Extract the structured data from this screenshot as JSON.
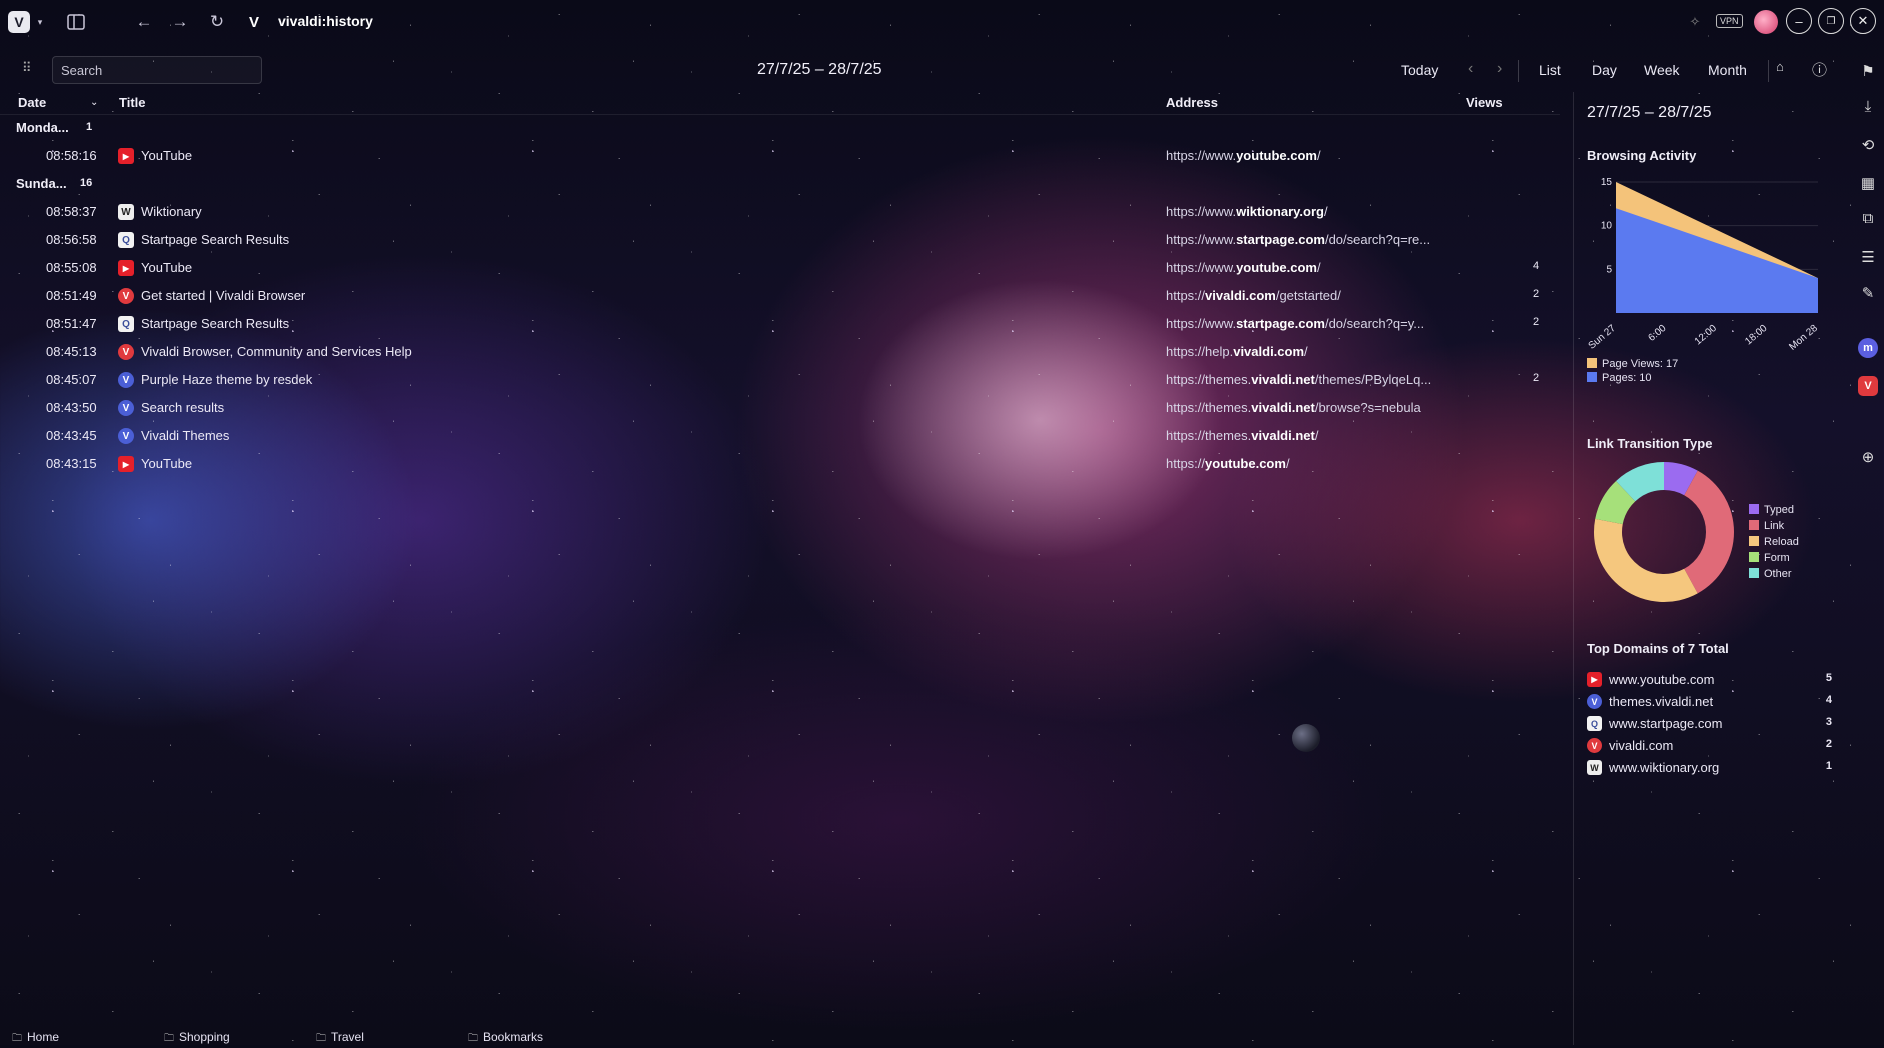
{
  "window": {
    "address": "vivaldi:history",
    "vpn_label": "VPN"
  },
  "toolbar": {
    "search_placeholder": "Search",
    "date_range": "27/7/25 – 28/7/25",
    "today": "Today",
    "views": [
      "List",
      "Day",
      "Week",
      "Month"
    ]
  },
  "table": {
    "headers": {
      "date": "Date",
      "title": "Title",
      "address": "Address",
      "views": "Views"
    },
    "groups": [
      {
        "label": "Monda...",
        "count": "1"
      },
      {
        "label": "Sunda...",
        "count": "16"
      }
    ],
    "rows": [
      {
        "time": "08:58:16",
        "icon": "youtube-favicon",
        "title": "YouTube",
        "url_pre": "https://www.",
        "url_bold": "youtube.com",
        "url_post": "/",
        "views": ""
      },
      {
        "time": "08:58:37",
        "icon": "wiktionary-favicon",
        "title": "Wiktionary",
        "url_pre": "https://www.",
        "url_bold": "wiktionary.org",
        "url_post": "/",
        "views": ""
      },
      {
        "time": "08:56:58",
        "icon": "startpage-favicon",
        "title": "Startpage Search Results",
        "url_pre": "https://www.",
        "url_bold": "startpage.com",
        "url_post": "/do/search?q=re...",
        "views": ""
      },
      {
        "time": "08:55:08",
        "icon": "youtube-favicon",
        "title": "YouTube",
        "url_pre": "https://www.",
        "url_bold": "youtube.com",
        "url_post": "/",
        "views": "4"
      },
      {
        "time": "08:51:49",
        "icon": "vivaldi-favicon",
        "title": "Get started | Vivaldi Browser",
        "url_pre": "https://",
        "url_bold": "vivaldi.com",
        "url_post": "/getstarted/",
        "views": "2"
      },
      {
        "time": "08:51:47",
        "icon": "startpage-favicon",
        "title": "Startpage Search Results",
        "url_pre": "https://www.",
        "url_bold": "startpage.com",
        "url_post": "/do/search?q=y...",
        "views": "2"
      },
      {
        "time": "08:45:13",
        "icon": "vivaldi-favicon",
        "title": "Vivaldi Browser, Community and Services Help",
        "url_pre": "https://help.",
        "url_bold": "vivaldi.com",
        "url_post": "/",
        "views": ""
      },
      {
        "time": "08:45:07",
        "icon": "vivaldi-themes-favicon",
        "title": "Purple Haze theme by resdek",
        "url_pre": "https://themes.",
        "url_bold": "vivaldi.net",
        "url_post": "/themes/PBylqeLq...",
        "views": "2"
      },
      {
        "time": "08:43:50",
        "icon": "vivaldi-themes-favicon",
        "title": "Search results",
        "url_pre": "https://themes.",
        "url_bold": "vivaldi.net",
        "url_post": "/browse?s=nebula",
        "views": ""
      },
      {
        "time": "08:43:45",
        "icon": "vivaldi-themes-favicon",
        "title": "Vivaldi Themes",
        "url_pre": "https://themes.",
        "url_bold": "vivaldi.net",
        "url_post": "/",
        "views": ""
      },
      {
        "time": "08:43:15",
        "icon": "youtube-favicon",
        "title": "YouTube",
        "url_pre": "https://",
        "url_bold": "youtube.com",
        "url_post": "/",
        "views": ""
      }
    ]
  },
  "panel": {
    "date_range": "27/7/25 – 28/7/25",
    "activity_title": "Browsing Activity",
    "transition_title": "Link Transition Type",
    "domains_title": "Top Domains of 7 Total",
    "domains": [
      {
        "icon": "youtube-favicon",
        "name": "www.youtube.com",
        "count": "5"
      },
      {
        "icon": "vivaldi-themes-favicon",
        "name": "themes.vivaldi.net",
        "count": "4"
      },
      {
        "icon": "startpage-favicon",
        "name": "www.startpage.com",
        "count": "3"
      },
      {
        "icon": "vivaldi-favicon",
        "name": "vivaldi.com",
        "count": "2"
      },
      {
        "icon": "wiktionary-favicon",
        "name": "www.wiktionary.org",
        "count": "1"
      }
    ]
  },
  "chart_data": [
    {
      "type": "area",
      "title": "Browsing Activity",
      "x": [
        "Sun 27",
        "6:00",
        "12:00",
        "18:00",
        "Mon 28"
      ],
      "yticks": [
        5,
        10,
        15
      ],
      "ylim": [
        0,
        15
      ],
      "series": [
        {
          "name": "Page Views: 17",
          "color": "#f4c37a",
          "start": 15,
          "end": 4
        },
        {
          "name": "Pages: 10",
          "color": "#5b7af0",
          "start": 12,
          "end": 4
        }
      ],
      "legend": "bottom"
    },
    {
      "type": "pie",
      "title": "Link Transition Type",
      "labels": [
        "Typed",
        "Link",
        "Reload",
        "Form",
        "Other"
      ],
      "colors": [
        "#9b6bf0",
        "#e06a78",
        "#f5c77e",
        "#a6e07a",
        "#7ee0d8"
      ],
      "values": [
        8,
        34,
        36,
        10,
        12
      ],
      "legend": "right"
    }
  ],
  "sidebar_icons": [
    "bookmarks-icon",
    "downloads-icon",
    "history-icon",
    "calendar-icon",
    "translate-icon",
    "reading-list-icon",
    "notes-icon",
    "mastodon-icon",
    "vivaldi-icon",
    "add-panel-icon"
  ],
  "bookmarks_bar": [
    "Home",
    "Shopping",
    "Travel",
    "Bookmarks"
  ]
}
